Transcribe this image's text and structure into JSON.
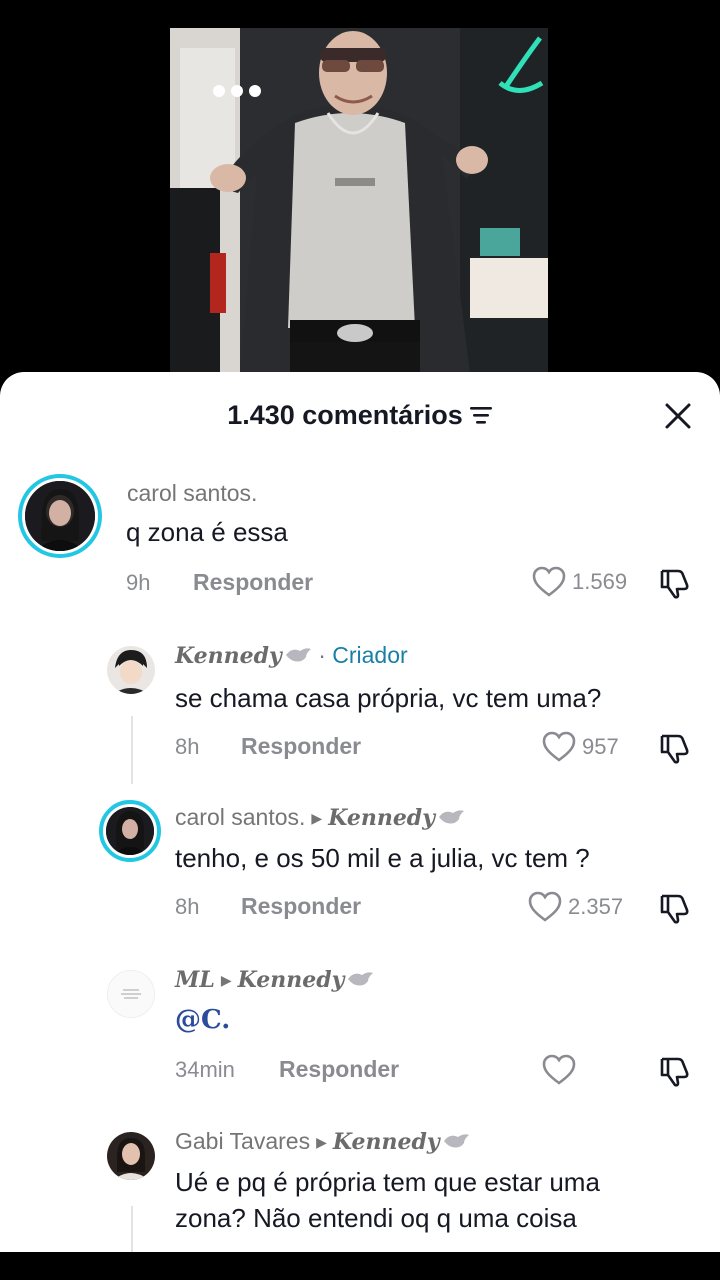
{
  "sheet": {
    "title": "1.430 comentários",
    "sort_icon": "sort-lines-icon",
    "close_icon": "close-icon"
  },
  "comments": [
    {
      "author": "carol santos.",
      "text": "q zona é essa",
      "time": "9h",
      "reply_label": "Responder",
      "likes": "1.569"
    },
    {
      "author": "Kennedy",
      "badge": "Criador",
      "badge_sep": "·",
      "text": "se chama casa própria, vc tem uma?",
      "time": "8h",
      "reply_label": "Responder",
      "likes": "957"
    },
    {
      "author": "carol santos.",
      "reply_to": "Kennedy",
      "text": "tenho, e os 50 mil e a julia, vc tem ?",
      "time": "8h",
      "reply_label": "Responder",
      "likes": "2.357"
    },
    {
      "author": "ML",
      "reply_to": "Kennedy",
      "text": "@C.",
      "time": "34min",
      "reply_label": "Responder",
      "likes": ""
    },
    {
      "author": "Gabi Tavares",
      "reply_to": "Kennedy",
      "text_line1": "Ué e pq é própria tem que estar uma",
      "text_line2": "zona? Não entendi oq q uma coisa"
    }
  ],
  "icons": {
    "like": "heart-outline-icon",
    "dislike": "thumbs-down-icon",
    "arrow": "reply-arrow-icon",
    "bird": "bird-emoji-icon",
    "more": "more-dots-icon"
  },
  "colors": {
    "accent_ring": "#23c7e3",
    "creator_tag": "#1a7fa6",
    "mention": "#2b4b9b"
  }
}
